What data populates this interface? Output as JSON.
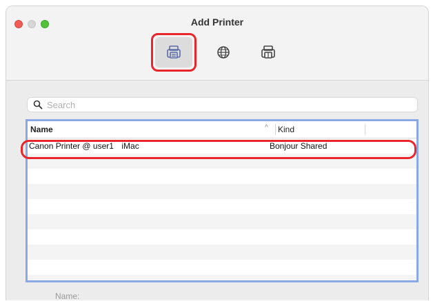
{
  "window": {
    "title": "Add Printer"
  },
  "toolbar": {
    "buttons": [
      {
        "name": "default",
        "icon": "printer-icon",
        "selected": true
      },
      {
        "name": "ip",
        "icon": "globe-icon",
        "selected": false
      },
      {
        "name": "windows",
        "icon": "windows-printer-icon",
        "selected": false
      }
    ]
  },
  "search": {
    "placeholder": "Search",
    "value": ""
  },
  "list": {
    "columns": [
      "Name",
      "Kind"
    ],
    "sort_indicator": "^",
    "rows": [
      {
        "name": "Canon Printer @ user1    iMac",
        "kind": "Bonjour Shared"
      }
    ]
  },
  "footer": {
    "name_label": "Name:"
  },
  "colors": {
    "highlight": "#e8252b",
    "focus_ring": "#8aa7e6"
  }
}
